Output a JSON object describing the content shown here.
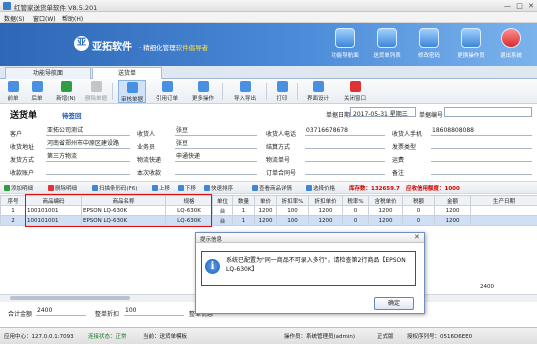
{
  "window": {
    "title": "红管家送货单软件 V8.5.201",
    "controls": [
      "—",
      "□",
      "✕"
    ]
  },
  "menu": [
    "数据(S)",
    "窗口(W)",
    "帮助(H)"
  ],
  "banner": {
    "logo": "亚",
    "brand": "亚拓软件",
    "slogan_prefix": "· 精细化管理",
    "slogan_highlight": "软件倡导者",
    "buttons": [
      "功能导航面",
      "送货单列表",
      "修改密码",
      "更换操作员",
      "退出系统"
    ]
  },
  "tabs": [
    {
      "label": "功能导航面"
    },
    {
      "label": "送货单"
    }
  ],
  "toolbar": [
    "前单",
    "后单",
    "新增(N)",
    "删除单据",
    "保存(S)",
    "审核单据",
    "引用订单",
    "更多操作",
    "导入导出",
    "打印",
    "界面设计",
    "关闭窗口"
  ],
  "form": {
    "title": "送货单",
    "status": "待签回",
    "date_label": "单据日期",
    "date_value": "2017-05-31 星期三",
    "number_label": "单据编号",
    "number_value": "",
    "rows": [
      [
        {
          "label": "客户",
          "value": "亚拓公司测试"
        },
        {
          "label": "收货人",
          "value": "张豆"
        },
        {
          "label": "收货人电话",
          "value": "03716678678"
        },
        {
          "label": "收货人手机",
          "value": "18608808088"
        }
      ],
      [
        {
          "label": "收货地址",
          "value": "河南省郑州市中原区建设路"
        },
        {
          "label": "业务员",
          "value": "张豆"
        },
        {
          "label": "结算方式",
          "value": ""
        },
        {
          "label": "发票类型",
          "value": ""
        }
      ],
      [
        {
          "label": "发货方式",
          "value": "第三方物流"
        },
        {
          "label": "物流快递",
          "value": "申通快递"
        },
        {
          "label": "物流单号",
          "value": ""
        },
        {
          "label": "运费",
          "value": ""
        }
      ],
      [
        {
          "label": "收款账户",
          "value": ""
        },
        {
          "label": "本次收款",
          "value": ""
        },
        {
          "label": "订单合同号",
          "value": ""
        },
        {
          "label": "备注",
          "value": ""
        }
      ]
    ]
  },
  "gridbar": {
    "buttons": [
      "添加明细",
      "删除明细",
      "扫描条形码(F6)",
      "上移",
      "下移",
      "快速排序",
      "查看商品详情",
      "选择价格"
    ],
    "stock": "库存数：132659.7",
    "credit": "应收信用额度：1000"
  },
  "grid": {
    "headers": [
      "序号",
      "商品编码",
      "商品名称",
      "规格",
      "单位",
      "数量",
      "单价",
      "折扣率%",
      "折扣单价",
      "税率%",
      "含税单价",
      "税额",
      "金额",
      "生产日期"
    ],
    "rows": [
      [
        "1",
        "100101001",
        "EPSON LQ-630K",
        "LQ-630K",
        "台",
        "1",
        "1200",
        "100",
        "1200",
        "0",
        "1200",
        "0",
        "1200",
        ""
      ],
      [
        "2",
        "100101001",
        "EPSON LQ-630K",
        "LQ-630K",
        "台",
        "1",
        "1200",
        "100",
        "1200",
        "0",
        "1200",
        "0",
        "1200",
        ""
      ]
    ],
    "totals": {
      "qty": "2",
      "amount": "2400"
    }
  },
  "bottom": {
    "total_label": "合计金额",
    "total_value": "2400",
    "discount_label": "整单折扣",
    "discount_value": "100",
    "discount_amount_label": "整单优惠"
  },
  "statusbar": {
    "server": "应用中心：127.0.0.1:7093",
    "connection": "连接状态：正常",
    "current": "当前：送货单模板",
    "operator": "操作员：系统管理员(admin)",
    "edition": "正式版",
    "license": "授权序列号：0516D6EE0"
  },
  "dialog": {
    "title": "提示信息",
    "message": "系统已配置为\"同一商品不可录入多行\"，请检查第2行商品【EPSON LQ-630K】",
    "ok": "确定"
  }
}
